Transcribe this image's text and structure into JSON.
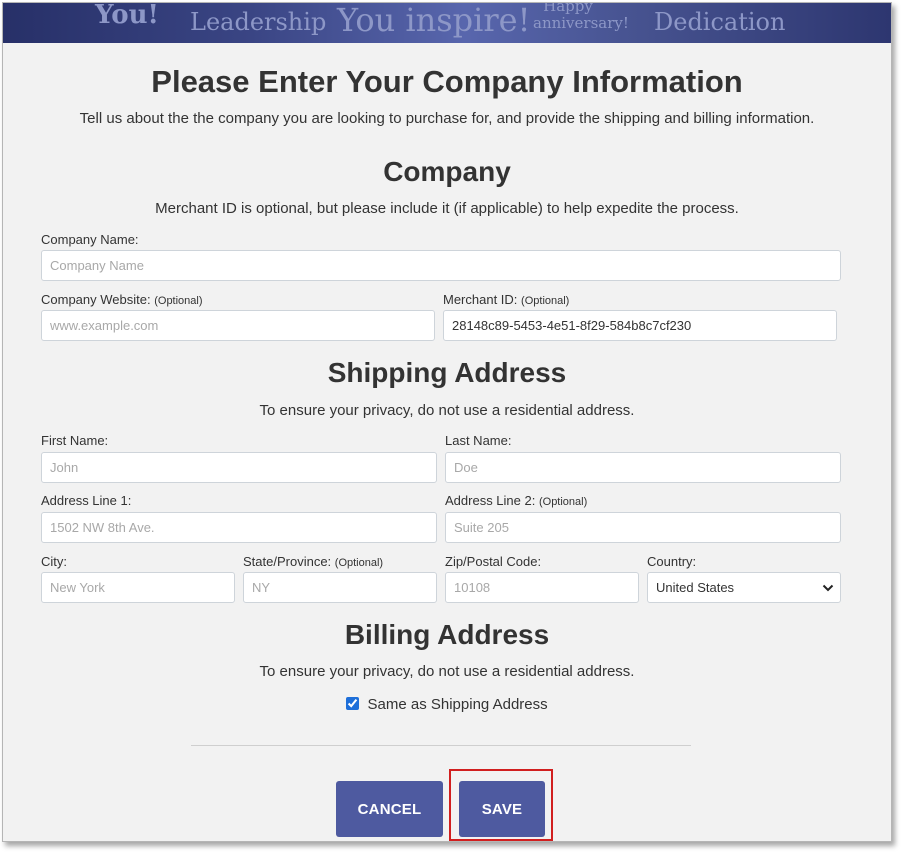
{
  "banner": {
    "words": [
      "You!",
      "Leadership",
      "You inspire!",
      "Happy anniversary!",
      "Dedication"
    ]
  },
  "header": {
    "title": "Please Enter Your Company Information",
    "subtitle": "Tell us about the the company you are looking to purchase for, and provide the shipping and billing information."
  },
  "company": {
    "title": "Company",
    "subtitle": "Merchant ID is optional, but please include it (if applicable) to help expedite the process.",
    "name_label": "Company Name:",
    "name_placeholder": "Company Name",
    "name_value": "",
    "website_label": "Company Website:",
    "website_optional": "(Optional)",
    "website_placeholder": "www.example.com",
    "website_value": "",
    "merchant_label": "Merchant ID:",
    "merchant_optional": "(Optional)",
    "merchant_value": "28148c89-5453-4e51-8f29-584b8c7cf230"
  },
  "shipping": {
    "title": "Shipping Address",
    "subtitle": "To ensure your privacy, do not use a residential address.",
    "first_label": "First Name:",
    "first_placeholder": "John",
    "last_label": "Last Name:",
    "last_placeholder": "Doe",
    "addr1_label": "Address Line 1:",
    "addr1_placeholder": "1502 NW 8th Ave.",
    "addr2_label": "Address Line 2:",
    "addr2_optional": "(Optional)",
    "addr2_placeholder": "Suite 205",
    "city_label": "City:",
    "city_placeholder": "New York",
    "state_label": "State/Province:",
    "state_optional": "(Optional)",
    "state_placeholder": "NY",
    "zip_label": "Zip/Postal Code:",
    "zip_placeholder": "10108",
    "country_label": "Country:",
    "country_selected": "United States"
  },
  "billing": {
    "title": "Billing Address",
    "subtitle": "To ensure your privacy, do not use a residential address.",
    "same_label": "Same as Shipping Address",
    "same_checked": true
  },
  "actions": {
    "cancel_label": "CANCEL",
    "save_label": "SAVE"
  },
  "colors": {
    "button": "#4e5aa0",
    "highlight": "#d11f1f",
    "banner": "#3a4584"
  }
}
